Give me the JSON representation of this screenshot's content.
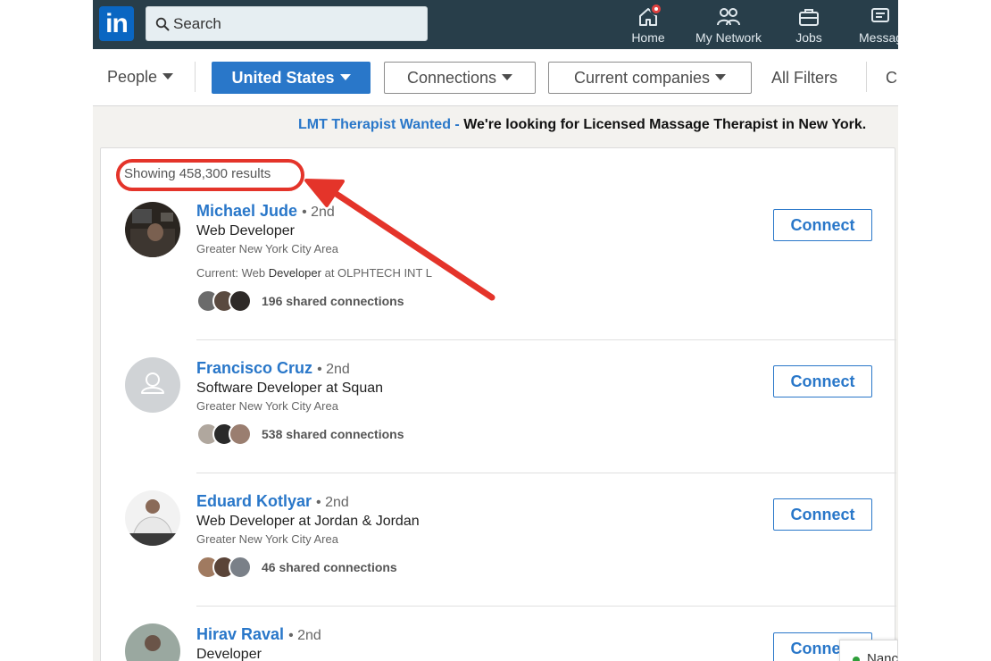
{
  "nav": {
    "logo_text": "in",
    "search_placeholder": "Search",
    "items": [
      {
        "label": "Home",
        "icon": "home-icon",
        "has_badge": true
      },
      {
        "label": "My Network",
        "icon": "network-icon"
      },
      {
        "label": "Jobs",
        "icon": "briefcase-icon"
      },
      {
        "label": "Messaging",
        "icon": "messaging-icon"
      }
    ]
  },
  "filters": {
    "people": "People",
    "location": "United States",
    "connections": "Connections",
    "companies": "Current companies",
    "all_filters": "All Filters",
    "cut_item": "C"
  },
  "ad": {
    "link": "LMT Therapist Wanted -",
    "text": "We're looking for Licensed Massage Therapist in New York."
  },
  "results": {
    "count_text": "Showing 458,300 results",
    "connect_label": "Connect",
    "items": [
      {
        "name": "Michael Jude",
        "degree": "• 2nd",
        "headline": "Web Developer",
        "location": "Greater New York City Area",
        "current_prefix": "Current: Web",
        "current_bold": "Developer",
        "current_suffix": "at OLPHTECH INT L",
        "shared": "196 shared connections"
      },
      {
        "name": "Francisco Cruz",
        "degree": "• 2nd",
        "headline": "Software Developer at Squan",
        "location": "Greater New York City Area",
        "shared": "538 shared connections"
      },
      {
        "name": "Eduard Kotlyar",
        "degree": "• 2nd",
        "headline": "Web Developer at Jordan & Jordan",
        "location": "Greater New York City Area",
        "shared": "46 shared connections"
      },
      {
        "name": "Hirav Raval",
        "degree": "• 2nd",
        "headline": "Developer"
      }
    ]
  },
  "messaging_popup": {
    "name": "Nanc"
  },
  "colors": {
    "nav_bg": "#283e4a",
    "brand_blue": "#2977c9",
    "annotation_red": "#e4342a"
  }
}
